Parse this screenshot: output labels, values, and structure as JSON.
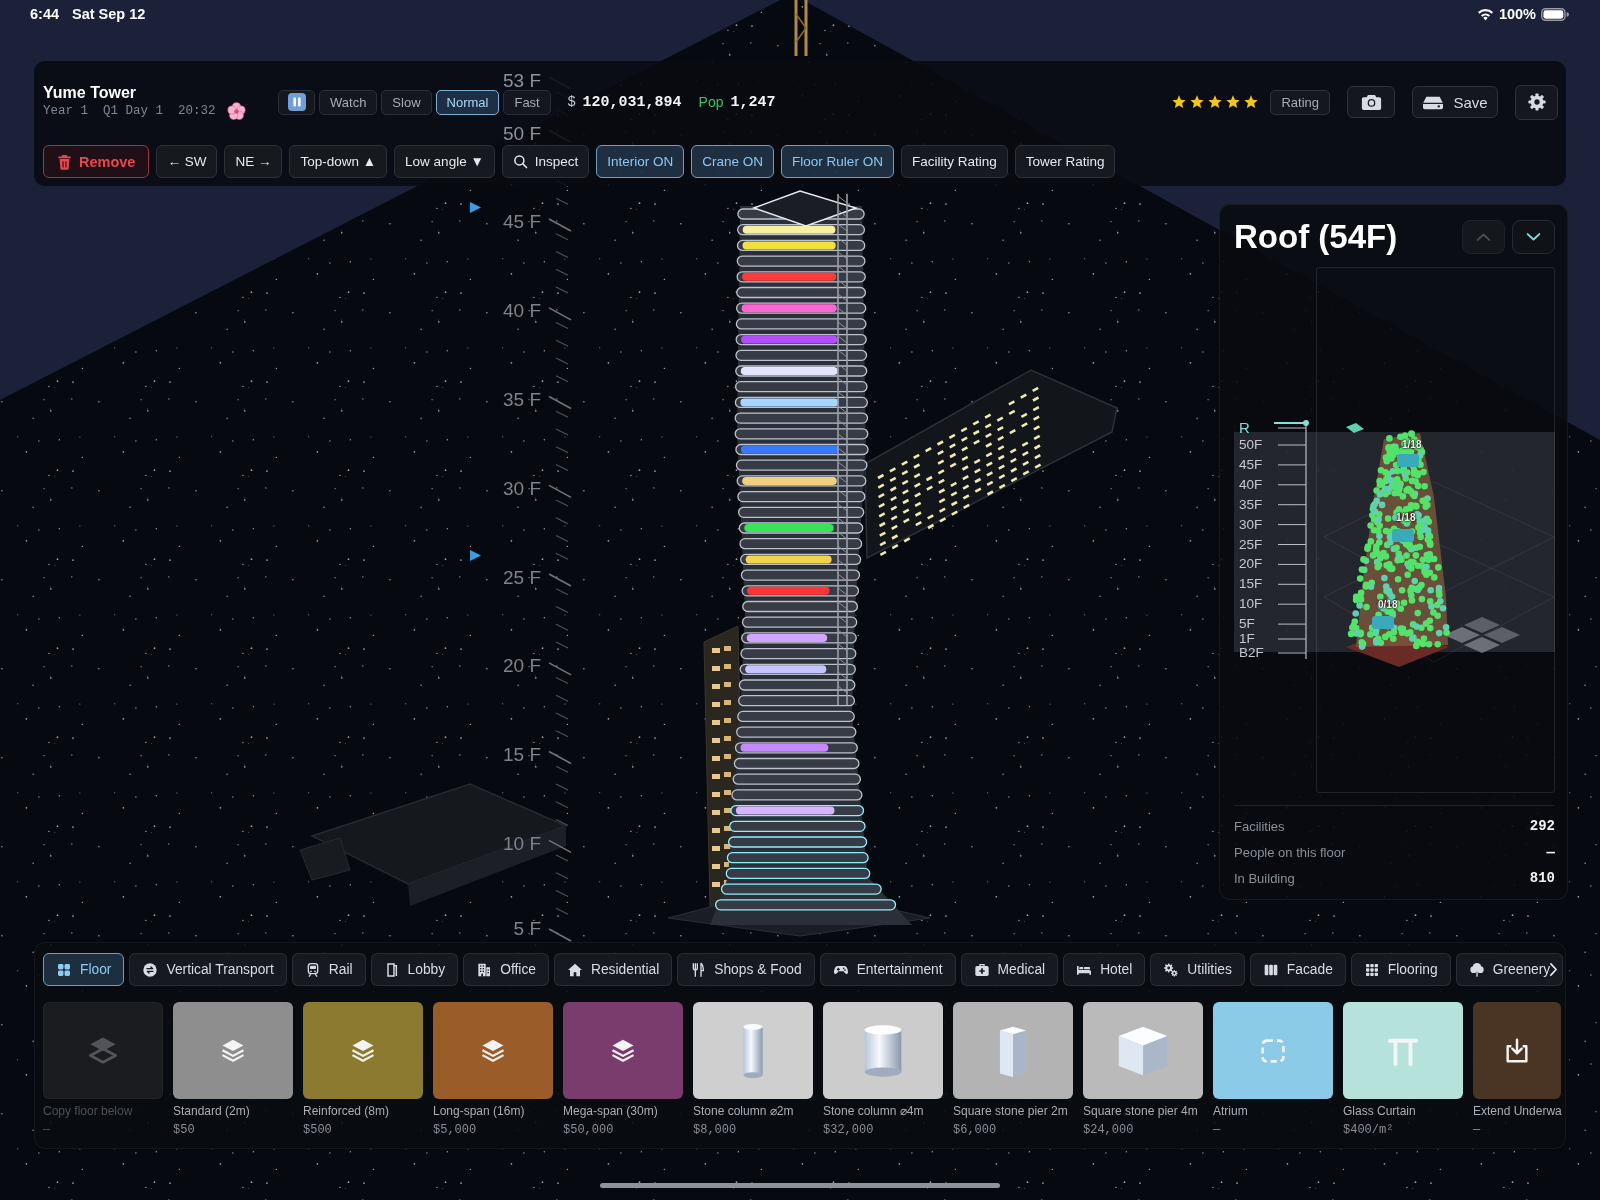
{
  "status_bar": {
    "time": "6:44",
    "date": "Sat Sep 12",
    "battery": "100%"
  },
  "header": {
    "title": "Yume Tower",
    "subtitle": "Year 1  Q1 Day 1  20:32"
  },
  "speed": [
    {
      "kind": "pause",
      "selected": false
    },
    {
      "kind": "text",
      "label": "Watch",
      "selected": false
    },
    {
      "kind": "text",
      "label": "Slow",
      "selected": false
    },
    {
      "kind": "text",
      "label": "Normal",
      "selected": true
    },
    {
      "kind": "text",
      "label": "Fast",
      "selected": false
    }
  ],
  "money": {
    "symbol": "$",
    "amount": "120,031,894"
  },
  "population": {
    "label": "Pop",
    "value": "1,247"
  },
  "rating": {
    "stars": 5,
    "button": "Rating"
  },
  "actions": {
    "save": "Save"
  },
  "controls": [
    {
      "kind": "remove",
      "label": "Remove",
      "on": false
    },
    {
      "kind": "plain",
      "label": "← SW",
      "on": false
    },
    {
      "kind": "plain",
      "label": "NE →",
      "on": false
    },
    {
      "kind": "plain",
      "label": "Top-down ▲",
      "on": false
    },
    {
      "kind": "plain",
      "label": "Low angle ▼",
      "on": false
    },
    {
      "kind": "search",
      "label": "Inspect",
      "on": false
    },
    {
      "kind": "plain",
      "label": "Interior ON",
      "on": true
    },
    {
      "kind": "plain",
      "label": "Crane ON",
      "on": true
    },
    {
      "kind": "plain",
      "label": "Floor Ruler ON",
      "on": true
    },
    {
      "kind": "plain",
      "label": "Facility Rating",
      "on": false
    },
    {
      "kind": "plain",
      "label": "Tower Rating",
      "on": false
    }
  ],
  "scene": {
    "floor_labels": [
      "53 F",
      "50 F",
      "45 F",
      "40 F",
      "35 F",
      "30 F",
      "25 F",
      "20 F",
      "15 F",
      "10 F",
      "5 F"
    ]
  },
  "floor_panel": {
    "title": "Roof (54F)",
    "buttons": [
      {
        "kind": "up",
        "disabled": true
      },
      {
        "kind": "down",
        "disabled": false
      }
    ],
    "minimap": {
      "ruler": [
        {
          "label": "R",
          "selected": true
        },
        {
          "label": "50F",
          "selected": false
        },
        {
          "label": "45F",
          "selected": false
        },
        {
          "label": "40F",
          "selected": false
        },
        {
          "label": "35F",
          "selected": false
        },
        {
          "label": "30F",
          "selected": false
        },
        {
          "label": "25F",
          "selected": false
        },
        {
          "label": "20F",
          "selected": false
        },
        {
          "label": "15F",
          "selected": false
        },
        {
          "label": "10F",
          "selected": false
        },
        {
          "label": "5F",
          "selected": false
        },
        {
          "label": "1F",
          "selected": false
        },
        {
          "label": "B2F",
          "selected": false
        }
      ],
      "markers": [
        {
          "label": "1/18"
        },
        {
          "label": "1/18"
        },
        {
          "label": "0/18"
        }
      ]
    },
    "stats": [
      {
        "label": "Facilities",
        "value": "292"
      },
      {
        "label": "People on this floor",
        "value": "—"
      },
      {
        "label": "In Building",
        "value": "810"
      }
    ]
  },
  "categories": [
    {
      "kind": "grid",
      "label": "Floor",
      "selected": true
    },
    {
      "kind": "swap",
      "label": "Vertical Transport",
      "selected": false
    },
    {
      "kind": "train",
      "label": "Rail",
      "selected": false
    },
    {
      "kind": "door",
      "label": "Lobby",
      "selected": false
    },
    {
      "kind": "office",
      "label": "Office",
      "selected": false
    },
    {
      "kind": "house",
      "label": "Residential",
      "selected": false
    },
    {
      "kind": "cutlery",
      "label": "Shops & Food",
      "selected": false
    },
    {
      "kind": "gamepad",
      "label": "Entertainment",
      "selected": false
    },
    {
      "kind": "medkit",
      "label": "Medical",
      "selected": false
    },
    {
      "kind": "bed",
      "label": "Hotel",
      "selected": false
    },
    {
      "kind": "gears",
      "label": "Utilities",
      "selected": false
    },
    {
      "kind": "columns",
      "label": "Facade",
      "selected": false
    },
    {
      "kind": "dots",
      "label": "Flooring",
      "selected": false
    },
    {
      "kind": "tree",
      "label": "Greenery",
      "selected": false
    }
  ],
  "items": [
    {
      "kind": "copy",
      "label": "Copy floor below",
      "price": "—",
      "color": "#1a1c20",
      "disabled": true
    },
    {
      "kind": "layers",
      "label": "Standard (2m)",
      "price": "$50",
      "color": "#8e8e8e",
      "disabled": false
    },
    {
      "kind": "layers",
      "label": "Reinforced (8m)",
      "price": "$500",
      "color": "#8c7a30",
      "disabled": false
    },
    {
      "kind": "layers",
      "label": "Long-span (16m)",
      "price": "$5,000",
      "color": "#9a5c28",
      "disabled": false
    },
    {
      "kind": "layers",
      "label": "Mega-span (30m)",
      "price": "$50,000",
      "color": "#7a3c6c",
      "disabled": false
    },
    {
      "kind": "column",
      "label": "Stone column ⌀2m",
      "price": "$8,000",
      "color": "#cfcfcf",
      "disabled": false
    },
    {
      "kind": "drum",
      "label": "Stone column ⌀4m",
      "price": "$32,000",
      "color": "#cccccc",
      "disabled": false
    },
    {
      "kind": "pier",
      "label": "Square stone pier 2m",
      "price": "$6,000",
      "color": "#b3b3b3",
      "disabled": false
    },
    {
      "kind": "block",
      "label": "Square stone pier 4m",
      "price": "$24,000",
      "color": "#bababa",
      "disabled": false
    },
    {
      "kind": "atrium",
      "label": "Atrium",
      "price": "—",
      "color": "#8ccbe8",
      "disabled": false
    },
    {
      "kind": "curtain",
      "label": "Glass Curtain",
      "price": "$400/m²",
      "color": "#b5e3dc",
      "disabled": false
    },
    {
      "kind": "import",
      "label": "Extend Underwa",
      "price": "—",
      "color": "#4a3524",
      "disabled": false
    }
  ]
}
